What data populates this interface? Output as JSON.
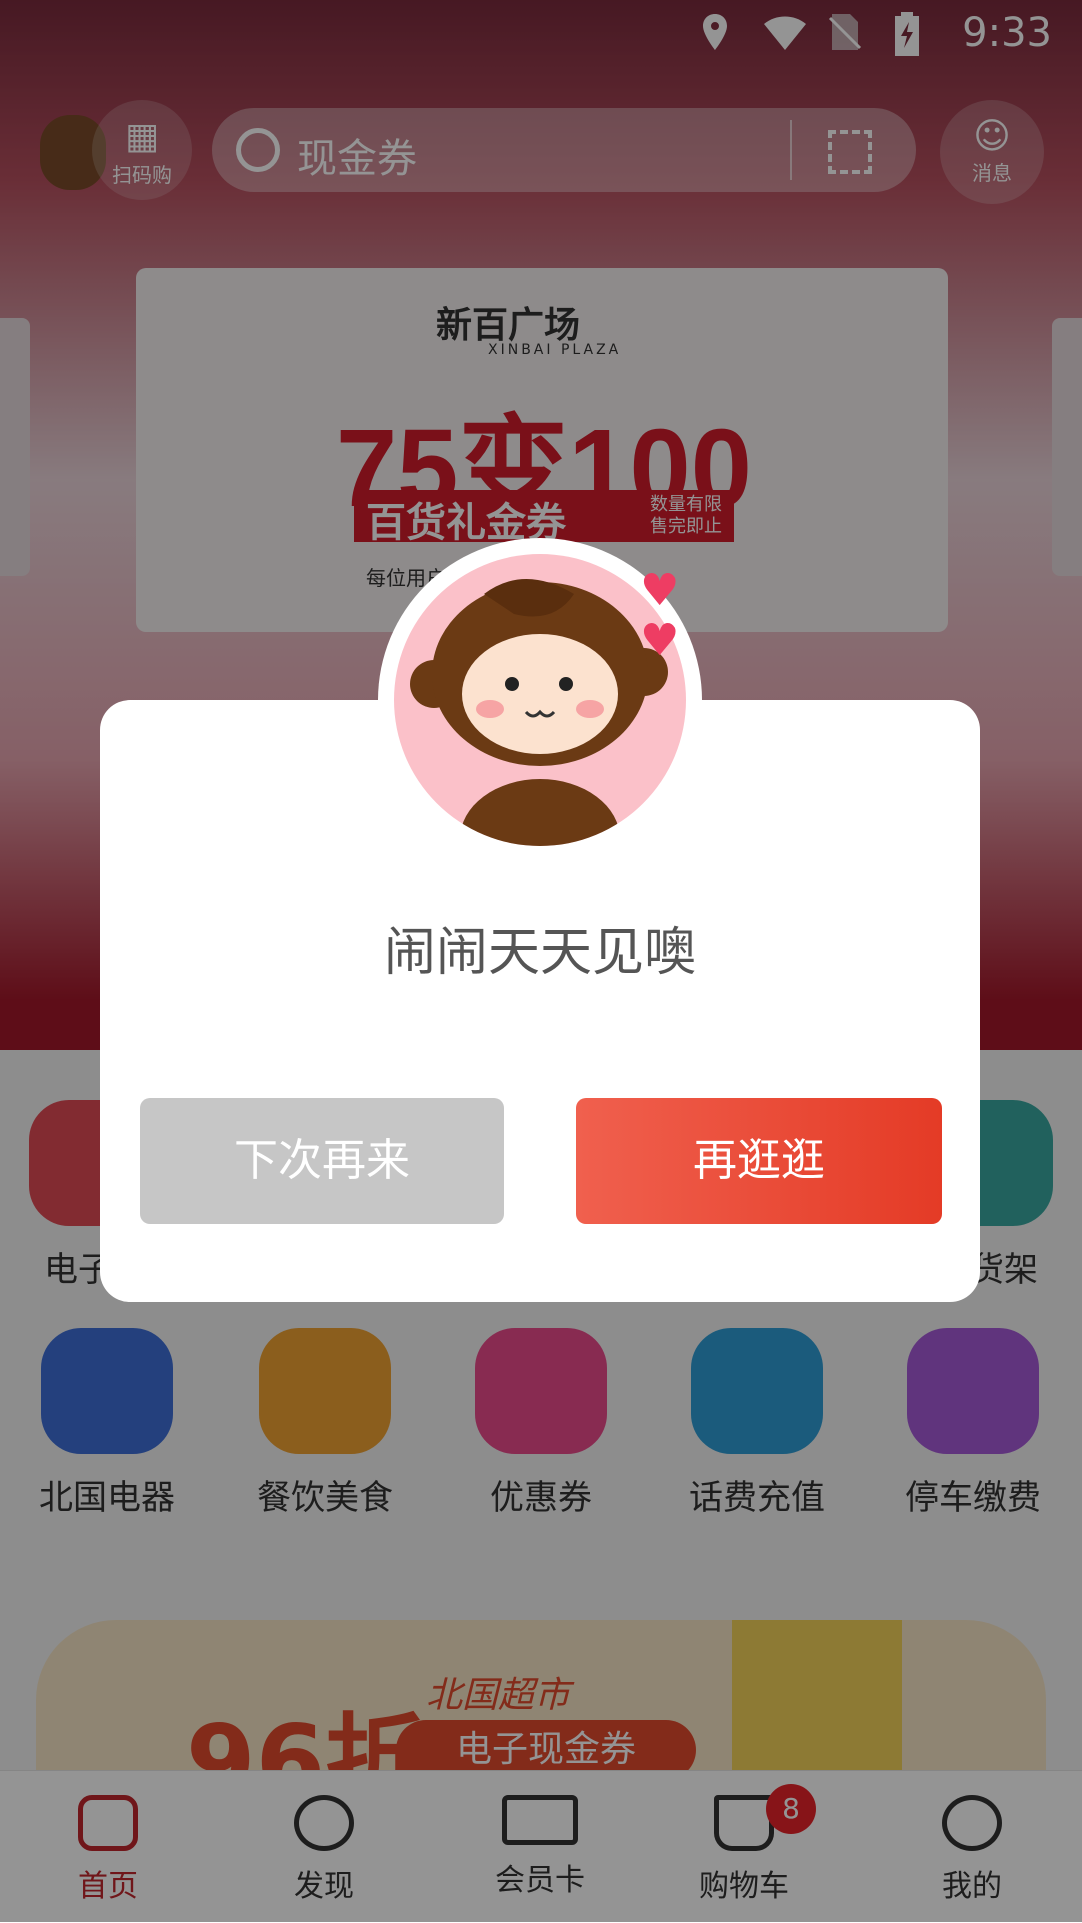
{
  "status_bar": {
    "time": "9:33"
  },
  "header": {
    "scan_label": "扫码购",
    "search_placeholder": "现金券",
    "message_label": "消息"
  },
  "banner": {
    "brand_cn": "新百广场",
    "brand_en": "XINBAI PLAZA",
    "headline": "75变100",
    "subtitle": "百货礼金券",
    "tag_line1": "数量有限",
    "tag_line2": "售完即止",
    "note": "每位用户限购…可10张"
  },
  "grid_row1": [
    {
      "label": "电子…",
      "color": "#e04a55"
    },
    {
      "label": "…货架",
      "color": "#3aa8a0"
    }
  ],
  "grid_row2": [
    {
      "label": "北国电器",
      "color": "#3e6fd8"
    },
    {
      "label": "餐饮美食",
      "color": "#f0a232"
    },
    {
      "label": "优惠券",
      "color": "#ea4a8c"
    },
    {
      "label": "话费充值",
      "color": "#2f9ed6"
    },
    {
      "label": "停车缴费",
      "color": "#a55ad8"
    }
  ],
  "promo": {
    "big_text": "96折",
    "brand": "北国超市",
    "chip": "电子现金券"
  },
  "tabbar": {
    "items": [
      {
        "label": "首页",
        "icon": "home-icon",
        "active": true
      },
      {
        "label": "发现",
        "icon": "compass-icon"
      },
      {
        "label": "会员卡",
        "icon": "card-icon"
      },
      {
        "label": "购物车",
        "icon": "cart-icon"
      },
      {
        "label": "我的",
        "icon": "monkey-face-icon"
      }
    ],
    "cart_badge": "8"
  },
  "dialog": {
    "title": "闹闹天天见噢",
    "cancel_label": "下次再来",
    "confirm_label": "再逛逛"
  },
  "colors": {
    "accent": "#e43b26",
    "active_tab": "#c2272d",
    "badge": "#e8242a",
    "cancel_button": "#c6c6c6"
  }
}
